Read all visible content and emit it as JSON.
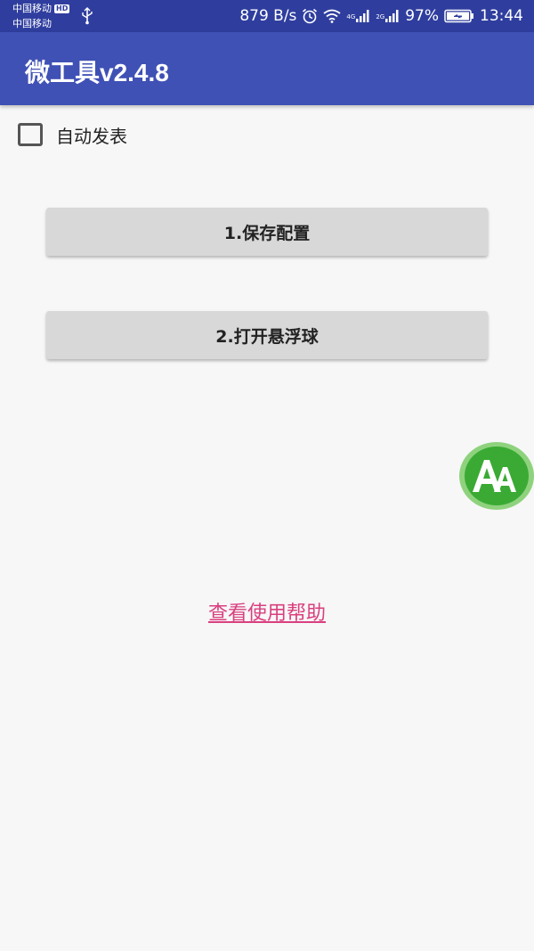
{
  "status_bar": {
    "carrier_1": "中国移动",
    "hd_badge": "HD",
    "carrier_2": "中国移动",
    "net_speed": "879 B/s",
    "signal_1_tag": "4G",
    "signal_2_tag": "2G",
    "battery_percent": "97%",
    "time": "13:44",
    "icons": [
      "usb-icon",
      "alarm-icon",
      "wifi-icon",
      "signal-icon",
      "battery-icon"
    ]
  },
  "app_bar": {
    "title": "微工具v2.4.8"
  },
  "auto_publish": {
    "label": "自动发表",
    "checked": false
  },
  "buttons": {
    "save_config": "1.保存配置",
    "open_float_ball": "2.打开悬浮球"
  },
  "float_ball": {
    "icon": "aa-logo-icon",
    "colors": {
      "outer": "#8fd27e",
      "inner": "#3aaa34"
    }
  },
  "help_link": "查看使用帮助",
  "colors": {
    "status_bar": "#2f3e9e",
    "app_bar": "#3f51b5",
    "link": "#d9407f",
    "button": "#d8d8d8",
    "background": "#f7f7f7"
  }
}
